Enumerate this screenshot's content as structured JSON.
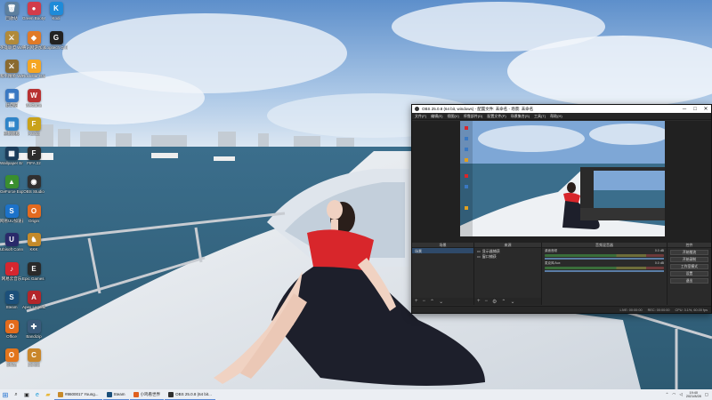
{
  "desktop": {
    "icons": [
      {
        "label": "回收站",
        "glyph": "🗑",
        "color": "#5d7f9e"
      },
      {
        "label": "Green BootyHunter",
        "glyph": "●",
        "color": "#d23b4a"
      },
      {
        "label": "Kodi",
        "glyph": "K",
        "color": "#1e8bd9"
      },
      {
        "label": "英雄联盟 WeGame版",
        "glyph": "⚔",
        "color": "#b18a3a"
      },
      {
        "label": "腾讯网游加速器",
        "glyph": "◆",
        "color": "#e07a28"
      },
      {
        "label": "Logitech G HUB",
        "glyph": "G",
        "color": "#222"
      },
      {
        "label": "和平精英 WeGame版",
        "glyph": "⚔",
        "color": "#8a6a30"
      },
      {
        "label": "Rockstar Games Launcher",
        "glyph": "R",
        "color": "#f5a623"
      },
      {
        "label": "此电脑",
        "glyph": "▣",
        "color": "#3a78c2"
      },
      {
        "label": "WeGame",
        "glyph": "W",
        "color": "#b83232"
      },
      {
        "label": "控制面板",
        "glyph": "▤",
        "color": "#2f84c8"
      },
      {
        "label": "Fallout",
        "glyph": "F",
        "color": "#c9a21a"
      },
      {
        "label": "Wallpaper Engine",
        "glyph": "▦",
        "color": "#1b3c5a"
      },
      {
        "label": "FIFA 22",
        "glyph": "F",
        "color": "#2c2c2c"
      },
      {
        "label": "GeForce Experience",
        "glyph": "▲",
        "color": "#3a8f2f"
      },
      {
        "label": "OBS Studio",
        "glyph": "◉",
        "color": "#303030"
      },
      {
        "label": "网易UU加速器",
        "glyph": "S",
        "color": "#1c72c9"
      },
      {
        "label": "Origin",
        "glyph": "O",
        "color": "#e26a1f"
      },
      {
        "label": "Ubisoft Connect",
        "glyph": "U",
        "color": "#2a2a6a"
      },
      {
        "label": "KKK",
        "glyph": "♞",
        "color": "#c48a2a"
      },
      {
        "label": "网易云音乐",
        "glyph": "♪",
        "color": "#d6262f"
      },
      {
        "label": "Epic Games Launcher",
        "glyph": "E",
        "color": "#2a2a2a"
      },
      {
        "label": "Steam",
        "glyph": "S",
        "color": "#1b4f7a"
      },
      {
        "label": "Apex Legends",
        "glyph": "A",
        "color": "#b3262a"
      },
      {
        "label": "Office",
        "glyph": "O",
        "color": "#e26b1c"
      },
      {
        "label": "Bandizip",
        "glyph": "✚",
        "color": "#3a5a7a"
      },
      {
        "label": "Office",
        "glyph": "O",
        "color": "#e2751c"
      },
      {
        "label": "CS:GO",
        "glyph": "C",
        "color": "#c9862a"
      }
    ]
  },
  "obs": {
    "title": "OBS 25.0.8 (64 bit, windows) - 配置文件: 未命名 - 场景: 未命名",
    "window_buttons": [
      "─",
      "□",
      "✕"
    ],
    "menu": [
      "文件(F)",
      "编辑(E)",
      "视图(V)",
      "停靠部件(D)",
      "配置文件(P)",
      "场景集合(S)",
      "工具(T)",
      "帮助(H)"
    ],
    "panels": {
      "scenes_header": "场景",
      "sources_header": "来源",
      "mixer_header": "音频混音器",
      "controls_header": "控件",
      "scenes": [
        "场景"
      ],
      "sources": [
        "显示器捕获",
        "窗口捕获"
      ],
      "mixer_channels": [
        {
          "name": "桌面音频",
          "db": "0.0 dB"
        },
        {
          "name": "麦克风/Aux",
          "db": "0.0 dB"
        }
      ],
      "controls": [
        "开始推流",
        "开始录制",
        "工作室模式",
        "设置",
        "退出"
      ],
      "footer_icons": [
        "+",
        "−",
        "⌃",
        "⌄"
      ]
    },
    "status": {
      "live": "LIVE: 00:00:00",
      "rec": "REC: 00:00:00",
      "cpu": "CPU: 3.1%, 60.00 fps"
    }
  },
  "taskbar": {
    "apps": [
      {
        "label": "#8600017 Young...",
        "color": "#c78a2a"
      },
      {
        "label": "Steam",
        "color": "#1b4f7a"
      },
      {
        "label": "小鸡看世界",
        "color": "#e06020"
      },
      {
        "label": "OBS 25.0.8 (64 bit...",
        "color": "#303030"
      }
    ],
    "time": "19:40",
    "date": "2021/8/28"
  }
}
